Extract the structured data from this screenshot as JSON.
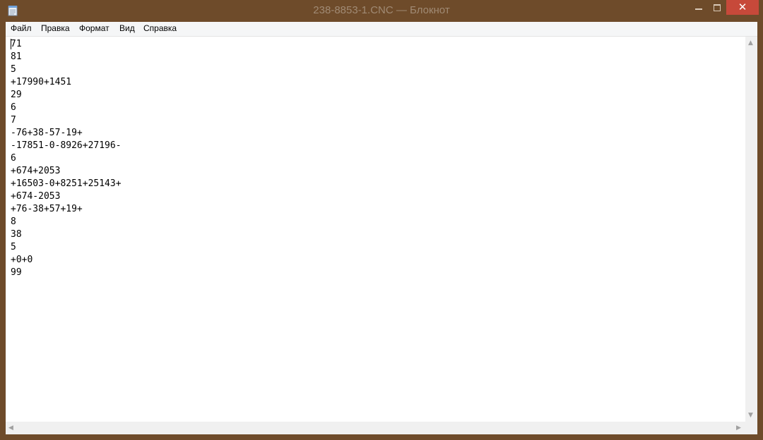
{
  "window": {
    "title": "238-8853-1.CNC — Блокнот",
    "close_glyph": "✕"
  },
  "menu": {
    "items": [
      "Файл",
      "Правка",
      "Формат",
      "Вид",
      "Справка"
    ]
  },
  "document": {
    "lines": [
      "71",
      "81",
      "5",
      "+17990+1451",
      "29",
      "6",
      "7",
      "-76+38-57-19+",
      "-17851-0-8926+27196-",
      "6",
      "+674+2053",
      "+16503-0+8251+25143+",
      "+674-2053",
      "+76-38+57+19+",
      "8",
      "38",
      "5",
      "+0+0",
      "99"
    ]
  },
  "scrollbar": {
    "up": "▲",
    "down": "▼",
    "left": "◀",
    "right": "▶"
  },
  "colors": {
    "frame": "#6e4b2a",
    "close_button": "#c7493a",
    "menu_bg": "#f5f6f7",
    "editor_bg": "#ffffff"
  }
}
